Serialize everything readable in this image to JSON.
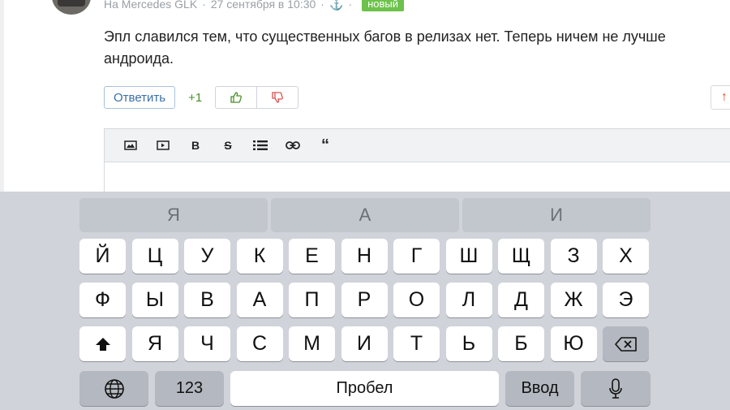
{
  "comment": {
    "meta": {
      "source": "На Mercedes GLK",
      "date": "27 сентября в 10:30",
      "anchor": "⚓",
      "badge": "новый"
    },
    "text": "Эпл славился тем, что существенных багов в релизах нет. Теперь ничем не лучше андроида.",
    "reply_label": "Ответить",
    "score": "+1",
    "up_arrow": "↑"
  },
  "editor": {
    "tools": [
      "image-icon",
      "video-icon",
      "bold",
      "strikethrough",
      "list-icon",
      "link-icon",
      "quote-icon"
    ],
    "bold_label": "B",
    "strike_label": "S",
    "quote_label": "“"
  },
  "keyboard": {
    "suggestions": [
      "Я",
      "А",
      "И"
    ],
    "row1": [
      "Й",
      "Ц",
      "У",
      "К",
      "Е",
      "Н",
      "Г",
      "Ш",
      "Щ",
      "З",
      "Х"
    ],
    "row2": [
      "Ф",
      "Ы",
      "В",
      "А",
      "П",
      "Р",
      "О",
      "Л",
      "Д",
      "Ж",
      "Э"
    ],
    "row3": [
      "Я",
      "Ч",
      "С",
      "М",
      "И",
      "Т",
      "Ь",
      "Б",
      "Ю"
    ],
    "numbers_label": "123",
    "space_label": "Пробел",
    "enter_label": "Ввод"
  }
}
